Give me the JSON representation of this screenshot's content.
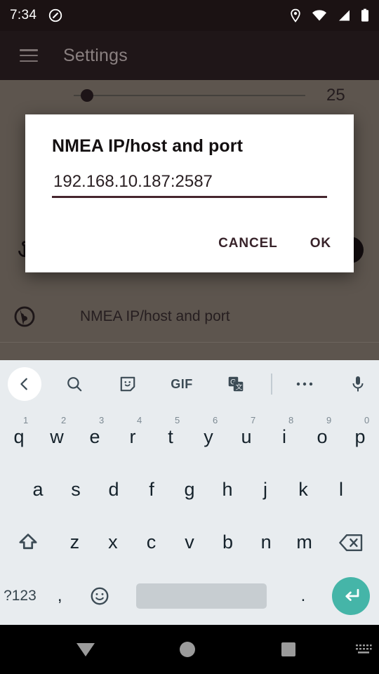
{
  "status_bar": {
    "time": "7:34",
    "icons": [
      "dnd-icon",
      "location-icon",
      "wifi-icon",
      "signal-icon",
      "battery-icon"
    ]
  },
  "app_bar": {
    "menu_icon": "hamburger-menu-icon",
    "title": "Settings"
  },
  "settings_background": {
    "slider_value": "25",
    "rows": [
      {
        "icon": "anchor-icon",
        "label": ""
      },
      {
        "icon": "globe-icon",
        "label": "NMEA IP/host and port"
      }
    ]
  },
  "dialog": {
    "title": "NMEA IP/host and port",
    "input_value": "192.168.10.187:2587",
    "input_placeholder": "",
    "cancel_label": "CANCEL",
    "ok_label": "OK",
    "accent_color": "#46262e"
  },
  "keyboard": {
    "toolbar": [
      {
        "name": "back-chevron-icon",
        "label": ""
      },
      {
        "name": "search-icon",
        "label": ""
      },
      {
        "name": "sticker-icon",
        "label": ""
      },
      {
        "name": "gif-icon",
        "label": "GIF"
      },
      {
        "name": "translate-icon",
        "label": ""
      },
      {
        "name": "overflow-menu-icon",
        "label": ""
      },
      {
        "name": "microphone-icon",
        "label": ""
      }
    ],
    "row1": [
      {
        "key": "q",
        "hint": "1"
      },
      {
        "key": "w",
        "hint": "2"
      },
      {
        "key": "e",
        "hint": "3"
      },
      {
        "key": "r",
        "hint": "4"
      },
      {
        "key": "t",
        "hint": "5"
      },
      {
        "key": "y",
        "hint": "6"
      },
      {
        "key": "u",
        "hint": "7"
      },
      {
        "key": "i",
        "hint": "8"
      },
      {
        "key": "o",
        "hint": "9"
      },
      {
        "key": "p",
        "hint": "0"
      }
    ],
    "row2": [
      {
        "key": "a"
      },
      {
        "key": "s"
      },
      {
        "key": "d"
      },
      {
        "key": "f"
      },
      {
        "key": "g"
      },
      {
        "key": "h"
      },
      {
        "key": "j"
      },
      {
        "key": "k"
      },
      {
        "key": "l"
      }
    ],
    "row3": [
      {
        "key": "z"
      },
      {
        "key": "x"
      },
      {
        "key": "c"
      },
      {
        "key": "v"
      },
      {
        "key": "b"
      },
      {
        "key": "n"
      },
      {
        "key": "m"
      }
    ],
    "shift_icon": "shift-icon",
    "backspace_icon": "backspace-icon",
    "row4": {
      "symbols_label": "?123",
      "comma_label": ",",
      "emoji_icon": "emoji-icon",
      "space_label": "",
      "period_label": ".",
      "enter_icon": "enter-icon",
      "enter_color": "#45b5a8"
    }
  },
  "nav_bar": {
    "back_icon": "hide-keyboard-icon",
    "home_icon": "home-icon",
    "recents_icon": "recents-icon",
    "switch_keyboard_icon": "switch-keyboard-icon"
  }
}
